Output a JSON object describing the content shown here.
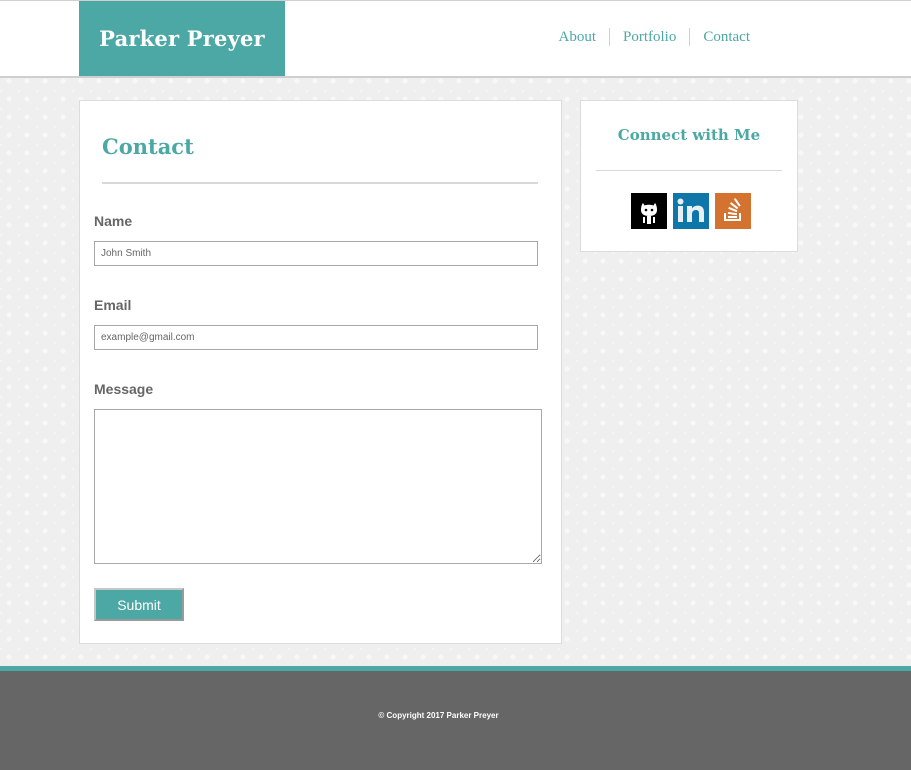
{
  "header": {
    "brand": "Parker Preyer",
    "nav": [
      "About",
      "Portfolio",
      "Contact"
    ]
  },
  "contact": {
    "title": "Contact",
    "name_label": "Name",
    "name_placeholder": "John Smith",
    "email_label": "Email",
    "email_placeholder": "example@gmail.com",
    "message_label": "Message",
    "submit_label": "Submit"
  },
  "connect": {
    "title": "Connect with Me",
    "icons": [
      "github-icon",
      "linkedin-icon",
      "stackoverflow-icon"
    ]
  },
  "footer": {
    "copyright": "© Copyright 2017 Parker Preyer"
  },
  "colors": {
    "accent": "#4ca8a5",
    "footer": "#666666",
    "github": "#000000",
    "linkedin": "#0e76a8",
    "stackoverflow": "#d4732f"
  }
}
